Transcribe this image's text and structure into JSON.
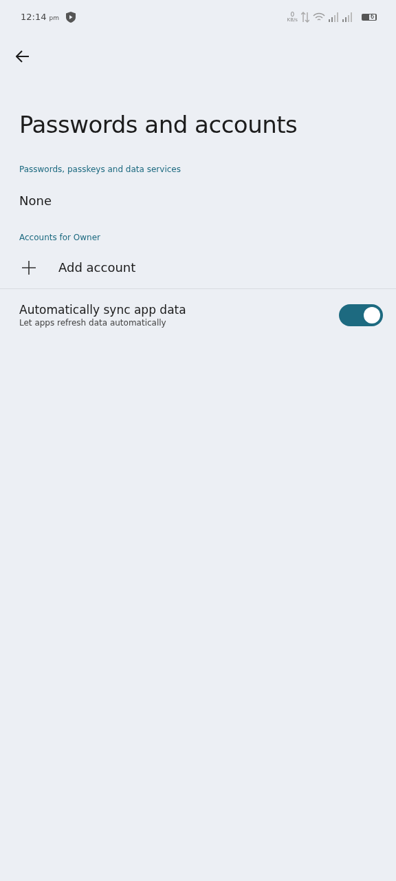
{
  "status_bar": {
    "time": "12:14",
    "ampm": "pm",
    "speed_value": "0",
    "speed_unit": "KB/s",
    "battery": "6"
  },
  "title": "Passwords and accounts",
  "sections": [
    {
      "header": "Passwords, passkeys and data services",
      "items": [
        {
          "kind": "text",
          "title": "None"
        }
      ]
    },
    {
      "header": "Accounts for Owner",
      "items": [
        {
          "kind": "add",
          "title": "Add account"
        }
      ]
    }
  ],
  "sync": {
    "title": "Automatically sync app data",
    "summary": "Let apps refresh data automatically",
    "on": true
  }
}
